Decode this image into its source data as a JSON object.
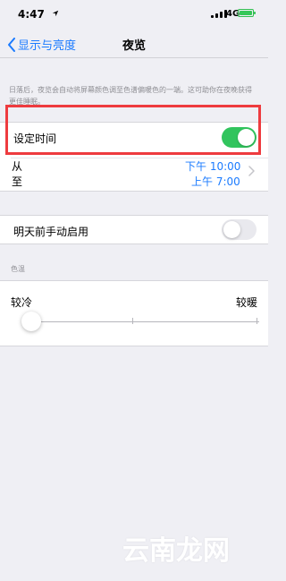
{
  "status_bar": {
    "time": "4:47",
    "network": "4G",
    "icons": [
      "location-arrow-icon",
      "signal-icon",
      "battery-icon"
    ]
  },
  "nav": {
    "back_label": "显示与亮度",
    "title": "夜览"
  },
  "description": "日落后，夜览会自动将屏幕颜色调至色谱偏暖色的一端。这可助你在夜晚获得更佳睡眠。",
  "schedule": {
    "set_time_label": "设定时间",
    "set_time_on": true,
    "from_label": "从",
    "to_label": "至",
    "from_time": "下午 10:00",
    "to_time": "上午 7:00"
  },
  "manual": {
    "label": "明天前手动启用",
    "enabled": false
  },
  "color_temperature": {
    "heading": "色温",
    "min_label": "较冷",
    "max_label": "较暖",
    "level_fraction": 0.0
  },
  "watermark": "云南龙网",
  "colors": {
    "accent": "#1b7bff",
    "toggle_on": "#31c45d",
    "highlight": "#ee3b3f",
    "background": "#efeff4"
  }
}
